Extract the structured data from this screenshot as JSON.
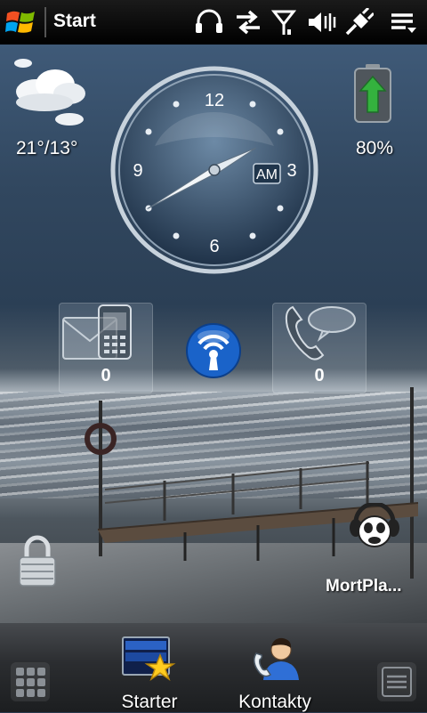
{
  "status_bar": {
    "title": "Start",
    "icons": [
      "windows-logo-icon",
      "headset-icon",
      "data-transfer-icon",
      "signal-icon",
      "volume-muted-icon",
      "power-plug-icon",
      "menu-icon"
    ]
  },
  "weather": {
    "temperature": "21°/13°",
    "icon": "cloud-icon"
  },
  "clock": {
    "numerals": [
      "12",
      "3",
      "6",
      "9"
    ],
    "period": "AM",
    "hour_hand_deg": 62,
    "minute_hand_deg": 240
  },
  "battery": {
    "percent_label": "80%",
    "level": 0.8,
    "icon": "battery-charging-icon"
  },
  "tiles": {
    "messages": {
      "count": "0",
      "icon": "messages-phone-icon"
    },
    "wifi": {
      "icon": "wifi-icon"
    },
    "calls": {
      "count": "0",
      "icon": "missed-calls-icon"
    }
  },
  "shortcuts": {
    "lock": {
      "icon": "lock-icon"
    },
    "mortplayer": {
      "label": "MortPla...",
      "icon": "mortplayer-icon"
    }
  },
  "bottom_bar": {
    "apps": [
      {
        "label": "Starter",
        "icon": "starter-icon"
      },
      {
        "label": "Kontakty",
        "icon": "contacts-icon"
      }
    ]
  },
  "colors": {
    "wifi_blue": "#1a63c9",
    "battery_green": "#2fb13a",
    "status_bg": "#000000"
  }
}
